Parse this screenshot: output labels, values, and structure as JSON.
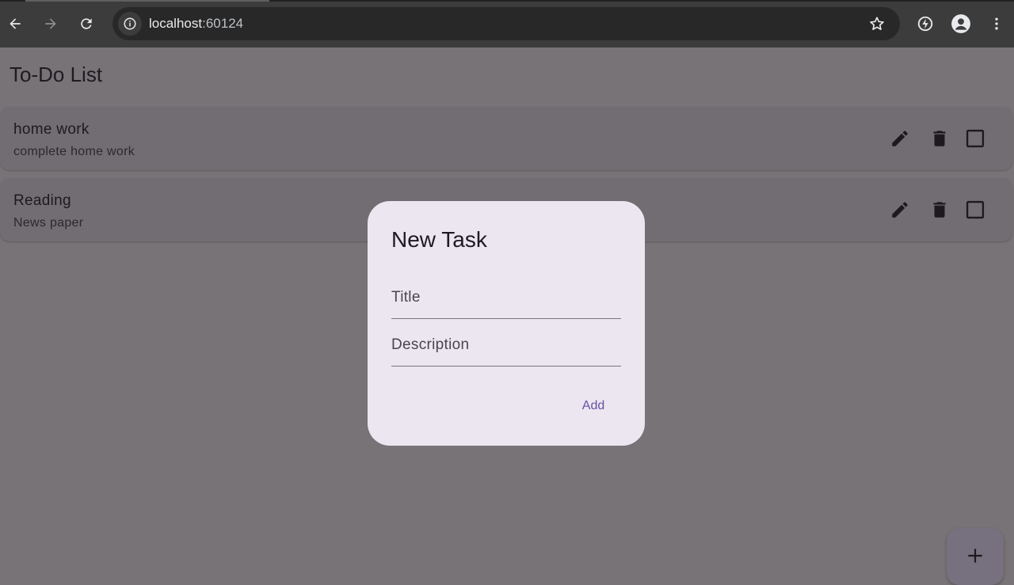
{
  "browser": {
    "url_host": "localhost",
    "url_port": ":60124"
  },
  "app": {
    "title": "To-Do List"
  },
  "tasks": [
    {
      "title": "home work",
      "description": "complete home work"
    },
    {
      "title": "Reading",
      "description": "News paper"
    }
  ],
  "dialog": {
    "title": "New Task",
    "title_placeholder": "Title",
    "description_placeholder": "Description",
    "add_label": "Add"
  },
  "colors": {
    "accent": "#6750a4",
    "dialog_bg": "#ece6f0",
    "scrim_bg": "#787377"
  },
  "icons": {
    "edit": "pencil-icon",
    "delete": "trash-icon",
    "complete": "checkbox-outline-icon",
    "fab": "plus-icon"
  }
}
